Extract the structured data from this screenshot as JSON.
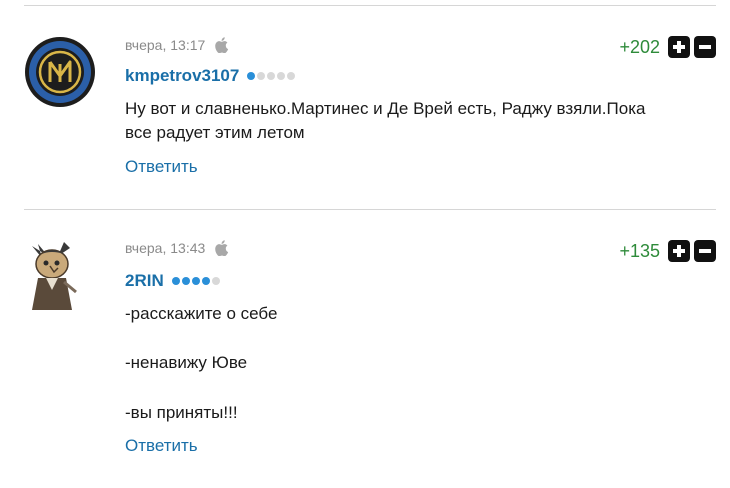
{
  "comments": [
    {
      "timestamp": "вчера, 13:17",
      "username": "kmpetrov3107",
      "rank_dots": [
        true,
        false,
        false,
        false,
        false
      ],
      "score": "+202",
      "lines": [
        "Ну вот и славненько.Мартинес и Де Врей есть, Раджу взяли.Пока",
        "все радует этим летом"
      ],
      "reply_label": "Ответить",
      "avatar": "inter-logo"
    },
    {
      "timestamp": "вчера, 13:43",
      "username": "2RIN",
      "rank_dots": [
        true,
        true,
        true,
        true,
        false
      ],
      "score": "+135",
      "lines": [
        "-расскажите о себе",
        "-ненавижу Юве",
        "-вы приняты!!!"
      ],
      "reply_label": "Ответить",
      "avatar": "cartoon-character"
    }
  ],
  "icons": {
    "device": "apple-icon",
    "upvote": "plus-icon",
    "downvote": "minus-icon"
  },
  "colors": {
    "username": "#1a6fa8",
    "score": "#2e8b3a",
    "reply": "#1a6fa8",
    "rank_on": "#2a8fd8"
  }
}
